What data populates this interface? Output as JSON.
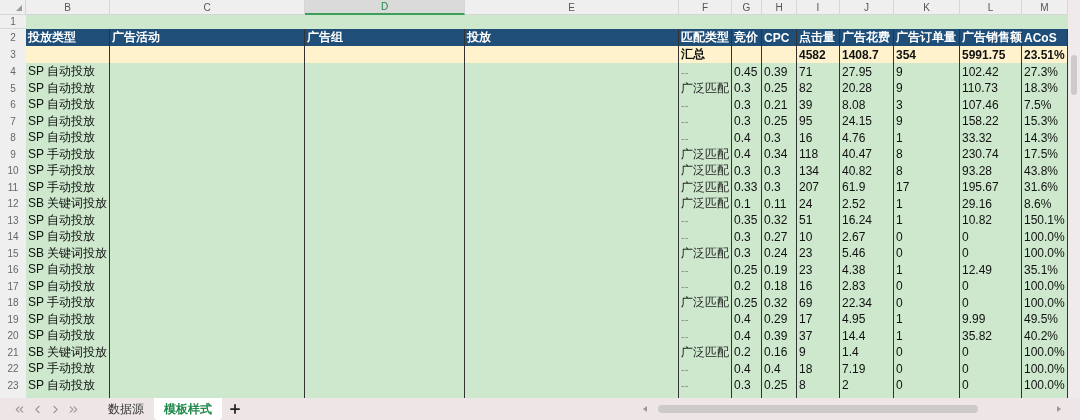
{
  "columns": [
    {
      "label": "B",
      "selected": false
    },
    {
      "label": "C",
      "selected": false
    },
    {
      "label": "D",
      "selected": true
    },
    {
      "label": "E",
      "selected": false
    },
    {
      "label": "F",
      "selected": false
    },
    {
      "label": "G",
      "selected": false
    },
    {
      "label": "H",
      "selected": false
    },
    {
      "label": "I",
      "selected": false
    },
    {
      "label": "J",
      "selected": false
    },
    {
      "label": "K",
      "selected": false
    },
    {
      "label": "L",
      "selected": false
    },
    {
      "label": "M",
      "selected": false
    }
  ],
  "blank_row": {
    "num": "1"
  },
  "header_row": {
    "num": "2",
    "labels": [
      "投放类型",
      "广告活动",
      "广告组",
      "投放",
      "匹配类型",
      "竞价",
      "CPC",
      "点击量",
      "广告花费",
      "广告订单量",
      "广告销售额",
      "ACoS"
    ]
  },
  "summary_row": {
    "num": "3",
    "label": "汇总",
    "clicks": "4582",
    "spend": "1408.7",
    "orders": "354",
    "sales": "5991.75",
    "acos": "23.51%"
  },
  "rows": [
    {
      "num": "4",
      "type": "SP 自动投放",
      "match": {
        "text": "--",
        "dim": true
      },
      "values": [
        "0.45",
        "0.39",
        "71",
        "27.95",
        "9",
        "102.42",
        "27.3%"
      ]
    },
    {
      "num": "5",
      "type": "SP 自动投放",
      "match": {
        "text": "广泛匹配",
        "dim": false
      },
      "values": [
        "0.3",
        "0.25",
        "82",
        "20.28",
        "9",
        "110.73",
        "18.3%"
      ]
    },
    {
      "num": "6",
      "type": "SP 自动投放",
      "match": {
        "text": "--",
        "dim": true
      },
      "values": [
        "0.3",
        "0.21",
        "39",
        "8.08",
        "3",
        "107.46",
        "7.5%"
      ]
    },
    {
      "num": "7",
      "type": "SP 自动投放",
      "match": {
        "text": "--",
        "dim": true
      },
      "values": [
        "0.3",
        "0.25",
        "95",
        "24.15",
        "9",
        "158.22",
        "15.3%"
      ]
    },
    {
      "num": "8",
      "type": "SP 自动投放",
      "match": {
        "text": "--",
        "dim": true
      },
      "values": [
        "0.4",
        "0.3",
        "16",
        "4.76",
        "1",
        "33.32",
        "14.3%"
      ]
    },
    {
      "num": "9",
      "type": "SP 手动投放",
      "match": {
        "text": "广泛匹配",
        "dim": false
      },
      "values": [
        "0.4",
        "0.34",
        "118",
        "40.47",
        "8",
        "230.74",
        "17.5%"
      ]
    },
    {
      "num": "10",
      "type": "SP 手动投放",
      "match": {
        "text": "广泛匹配",
        "dim": false
      },
      "values": [
        "0.3",
        "0.3",
        "134",
        "40.82",
        "8",
        "93.28",
        "43.8%"
      ]
    },
    {
      "num": "11",
      "type": "SP 手动投放",
      "match": {
        "text": "广泛匹配",
        "dim": false
      },
      "values": [
        "0.33",
        "0.3",
        "207",
        "61.9",
        "17",
        "195.67",
        "31.6%"
      ]
    },
    {
      "num": "12",
      "type": "SB 关键词投放",
      "match": {
        "text": "广泛匹配",
        "dim": false
      },
      "values": [
        "0.1",
        "0.11",
        "24",
        "2.52",
        "1",
        "29.16",
        "8.6%"
      ]
    },
    {
      "num": "13",
      "type": "SP 自动投放",
      "match": {
        "text": "--",
        "dim": true
      },
      "values": [
        "0.35",
        "0.32",
        "51",
        "16.24",
        "1",
        "10.82",
        "150.1%"
      ]
    },
    {
      "num": "14",
      "type": "SP 自动投放",
      "match": {
        "text": "--",
        "dim": true
      },
      "values": [
        "0.3",
        "0.27",
        "10",
        "2.67",
        "0",
        "0",
        "100.0%"
      ]
    },
    {
      "num": "15",
      "type": "SB 关键词投放",
      "match": {
        "text": "广泛匹配",
        "dim": false
      },
      "values": [
        "0.3",
        "0.24",
        "23",
        "5.46",
        "0",
        "0",
        "100.0%"
      ]
    },
    {
      "num": "16",
      "type": "SP 自动投放",
      "match": {
        "text": "--",
        "dim": true
      },
      "values": [
        "0.25",
        "0.19",
        "23",
        "4.38",
        "1",
        "12.49",
        "35.1%"
      ]
    },
    {
      "num": "17",
      "type": "SP 自动投放",
      "match": {
        "text": "--",
        "dim": true
      },
      "values": [
        "0.2",
        "0.18",
        "16",
        "2.83",
        "0",
        "0",
        "100.0%"
      ]
    },
    {
      "num": "18",
      "type": "SP 手动投放",
      "match": {
        "text": "广泛匹配",
        "dim": false
      },
      "values": [
        "0.25",
        "0.32",
        "69",
        "22.34",
        "0",
        "0",
        "100.0%"
      ]
    },
    {
      "num": "19",
      "type": "SP 自动投放",
      "match": {
        "text": "--",
        "dim": true
      },
      "values": [
        "0.4",
        "0.29",
        "17",
        "4.95",
        "1",
        "9.99",
        "49.5%"
      ]
    },
    {
      "num": "20",
      "type": "SP 自动投放",
      "match": {
        "text": "--",
        "dim": true
      },
      "values": [
        "0.4",
        "0.39",
        "37",
        "14.4",
        "1",
        "35.82",
        "40.2%"
      ]
    },
    {
      "num": "21",
      "type": "SB 关键词投放",
      "match": {
        "text": "广泛匹配",
        "dim": false
      },
      "values": [
        "0.2",
        "0.16",
        "9",
        "1.4",
        "0",
        "0",
        "100.0%"
      ]
    },
    {
      "num": "22",
      "type": "SP 手动投放",
      "match": {
        "text": "--",
        "dim": true
      },
      "values": [
        "0.4",
        "0.4",
        "18",
        "7.19",
        "0",
        "0",
        "100.0%"
      ]
    },
    {
      "num": "23",
      "type": "SP 自动投放",
      "match": {
        "text": "--",
        "dim": true
      },
      "values": [
        "0.3",
        "0.25",
        "8",
        "2",
        "0",
        "0",
        "100.0%"
      ]
    }
  ],
  "sheet_tabs": [
    {
      "label": "数据源",
      "selected": false
    },
    {
      "label": "模板样式",
      "selected": true
    }
  ]
}
